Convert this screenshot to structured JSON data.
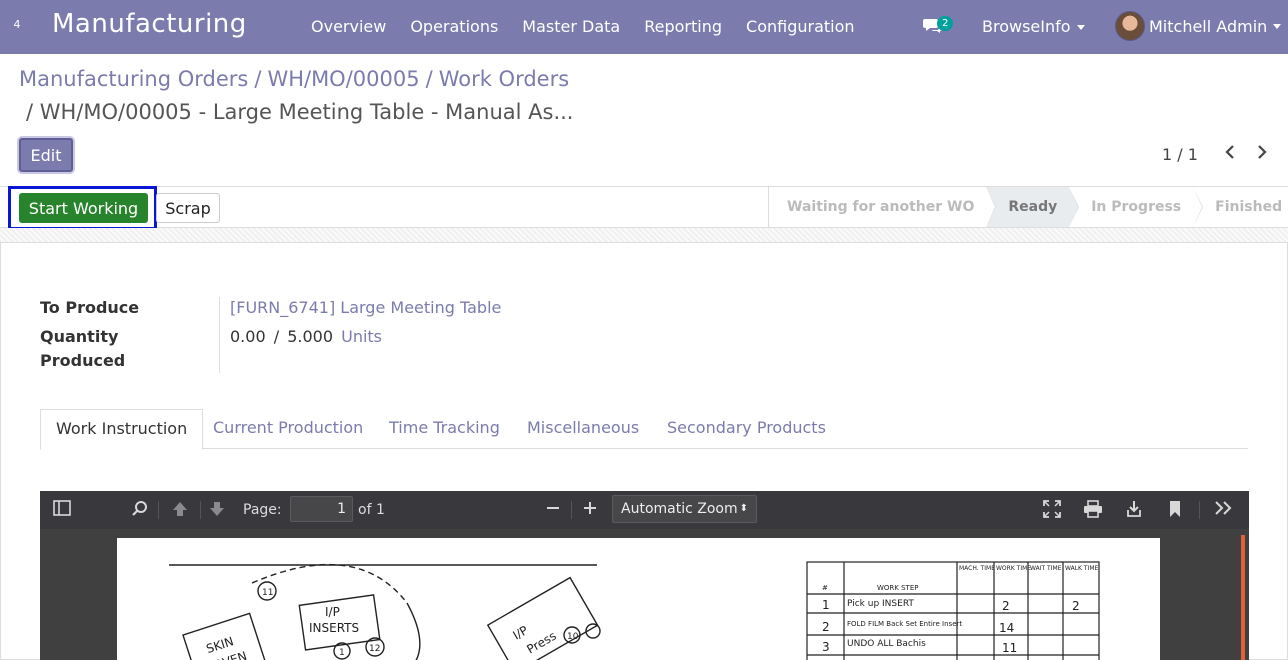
{
  "navbar": {
    "apps_indicator": "4",
    "brand": "Manufacturing",
    "menu": [
      "Overview",
      "Operations",
      "Master Data",
      "Reporting",
      "Configuration"
    ],
    "chat_count": "2",
    "company": "BrowseInfo",
    "user": "Mitchell Admin",
    "color": "#7c7bad"
  },
  "breadcrumb": {
    "items": [
      "Manufacturing Orders",
      "WH/MO/00005",
      "Work Orders"
    ],
    "current": "/ WH/MO/00005 - Large Meeting Table - Manual As..."
  },
  "buttons": {
    "edit": "Edit",
    "start_working": "Start Working",
    "scrap": "Scrap"
  },
  "pager": {
    "value": "1 / 1"
  },
  "stages": [
    {
      "label": "Waiting for another WO",
      "active": false
    },
    {
      "label": "Ready",
      "active": true
    },
    {
      "label": "In Progress",
      "active": false
    },
    {
      "label": "Finished",
      "active": false
    }
  ],
  "form": {
    "to_produce_label": "To Produce",
    "to_produce_value": "[FURN_6741] Large Meeting Table",
    "qty_label_line1": "Quantity",
    "qty_label_line2": "Produced",
    "qty_produced": "0.00",
    "qty_sep": "/",
    "qty_total": "5.000",
    "qty_uom": "Units"
  },
  "tabs": [
    {
      "label": "Work Instruction",
      "active": true
    },
    {
      "label": "Current Production",
      "active": false
    },
    {
      "label": "Time Tracking",
      "active": false
    },
    {
      "label": "Miscellaneous",
      "active": false
    },
    {
      "label": "Secondary Products",
      "active": false
    }
  ],
  "pdf_viewer": {
    "page_label": "Page:",
    "page_value": "1",
    "page_of": "of 1",
    "zoom": "Automatic Zoom",
    "icons": [
      "sidebar-icon",
      "search-icon",
      "prev-page-icon",
      "next-page-icon",
      "zoom-out-icon",
      "zoom-in-icon",
      "presentation-icon",
      "print-icon",
      "download-icon",
      "bookmark-icon",
      "tools-icon"
    ]
  },
  "document": {
    "labels": [
      "SKIN",
      "OVEN",
      "I/P",
      "INSERTS",
      "I/P",
      "Press",
      "11",
      "12",
      "1",
      "10"
    ],
    "table_headers": [
      "#",
      "WORK STEP",
      "MACH. TIME",
      "WORK TIME",
      "WAIT TIME",
      "WALK TIME"
    ],
    "rows": [
      {
        "n": "1",
        "step": "Pick up INSERT",
        "work": "2",
        "walk": "2"
      },
      {
        "n": "2",
        "step": "FOLD FILM Back Set Entire Insert",
        "work": "14",
        "walk": ""
      },
      {
        "n": "3",
        "step": "UNDO ALL Bachis",
        "work": "11",
        "walk": ""
      }
    ]
  }
}
